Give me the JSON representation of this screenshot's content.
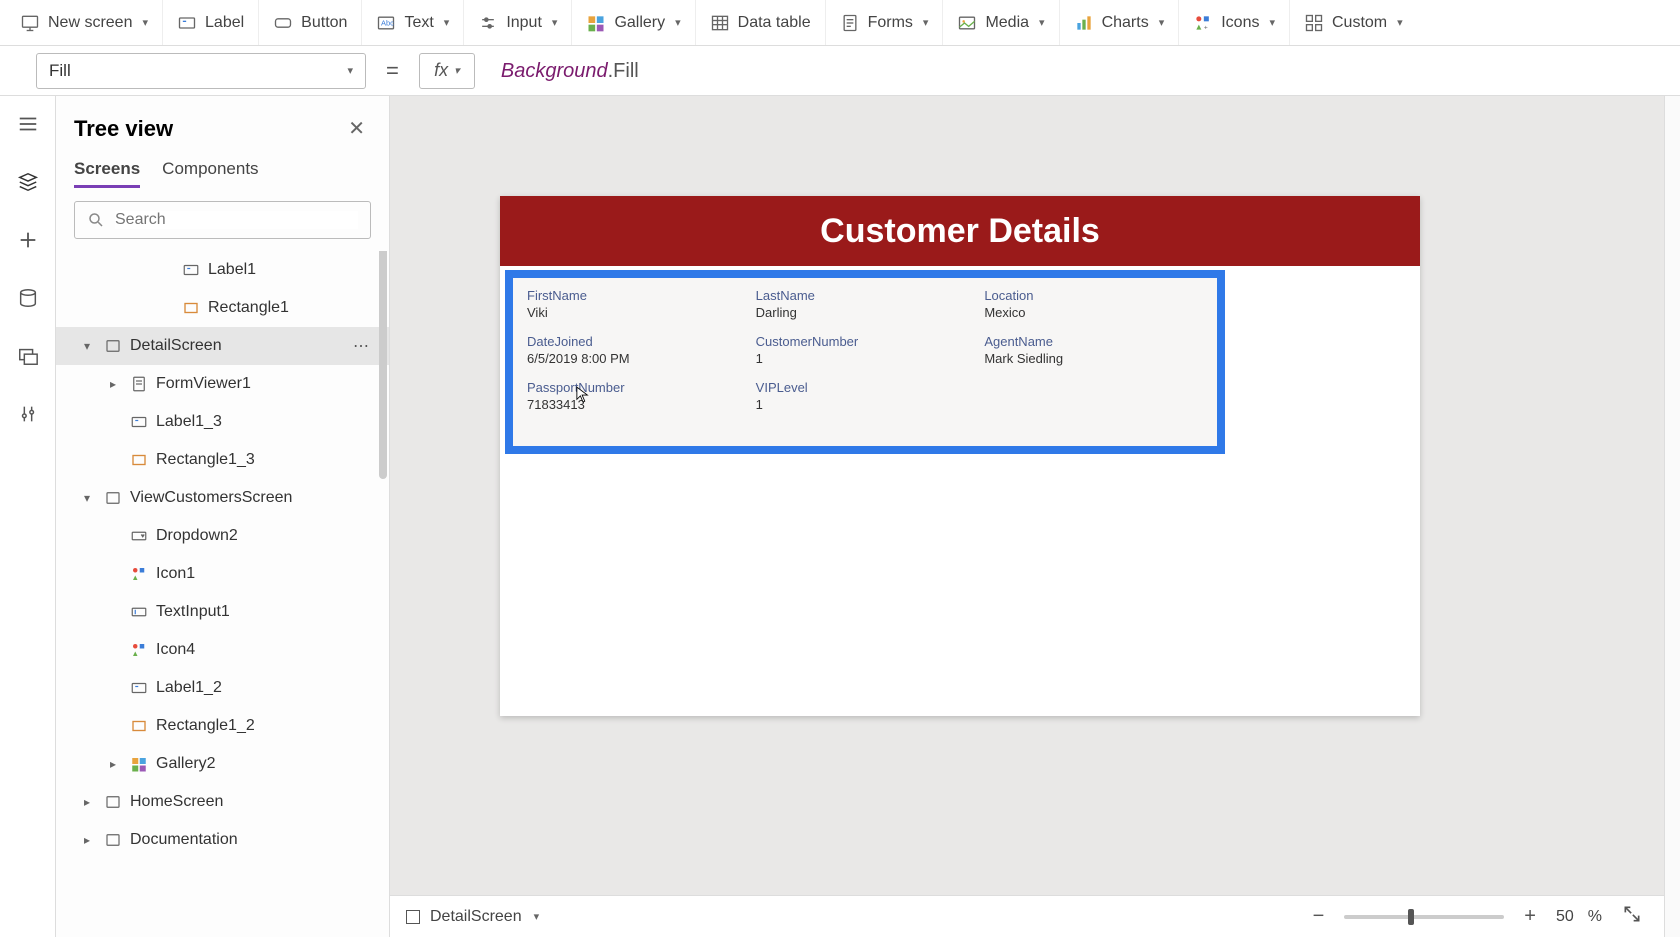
{
  "toolbar": {
    "new_screen": "New screen",
    "label": "Label",
    "button": "Button",
    "text": "Text",
    "input": "Input",
    "gallery": "Gallery",
    "data_table": "Data table",
    "forms": "Forms",
    "media": "Media",
    "charts": "Charts",
    "icons": "Icons",
    "custom": "Custom"
  },
  "formula": {
    "property": "Fill",
    "fx": "fx",
    "token1": "Background",
    "token2": ".Fill"
  },
  "panel": {
    "title": "Tree view",
    "tab_screens": "Screens",
    "tab_components": "Components",
    "search_placeholder": "Search"
  },
  "tree": [
    {
      "indent": 3,
      "icon": "label",
      "label": "Label1"
    },
    {
      "indent": 3,
      "icon": "rect",
      "label": "Rectangle1"
    },
    {
      "indent": 0,
      "chev": "down",
      "icon": "screen",
      "label": "DetailScreen",
      "selected": true,
      "more": true
    },
    {
      "indent": 1,
      "chev": "right",
      "icon": "form",
      "label": "FormViewer1"
    },
    {
      "indent": 1,
      "icon": "label",
      "label": "Label1_3"
    },
    {
      "indent": 1,
      "icon": "rect",
      "label": "Rectangle1_3"
    },
    {
      "indent": 0,
      "chev": "down",
      "icon": "screen",
      "label": "ViewCustomersScreen"
    },
    {
      "indent": 1,
      "icon": "dropdown",
      "label": "Dropdown2"
    },
    {
      "indent": 1,
      "icon": "iconctrl",
      "label": "Icon1"
    },
    {
      "indent": 1,
      "icon": "textinput",
      "label": "TextInput1"
    },
    {
      "indent": 1,
      "icon": "iconctrl",
      "label": "Icon4"
    },
    {
      "indent": 1,
      "icon": "label",
      "label": "Label1_2"
    },
    {
      "indent": 1,
      "icon": "rect",
      "label": "Rectangle1_2"
    },
    {
      "indent": 1,
      "chev": "right",
      "icon": "gallery",
      "label": "Gallery2"
    },
    {
      "indent": 0,
      "chev": "right",
      "icon": "screen",
      "label": "HomeScreen"
    },
    {
      "indent": 0,
      "chev": "right",
      "icon": "screen",
      "label": "Documentation"
    }
  ],
  "canvas": {
    "title": "Customer Details",
    "fields": [
      {
        "label": "FirstName",
        "value": "Viki"
      },
      {
        "label": "LastName",
        "value": "Darling"
      },
      {
        "label": "Location",
        "value": "Mexico"
      },
      {
        "label": "DateJoined",
        "value": "6/5/2019 8:00 PM"
      },
      {
        "label": "CustomerNumber",
        "value": "1"
      },
      {
        "label": "AgentName",
        "value": "Mark Siedling"
      },
      {
        "label": "PassportNumber",
        "value": "71833413"
      },
      {
        "label": "VIPLevel",
        "value": "1"
      }
    ]
  },
  "status": {
    "screen": "DetailScreen",
    "zoom": "50",
    "zoom_pct": "%"
  }
}
